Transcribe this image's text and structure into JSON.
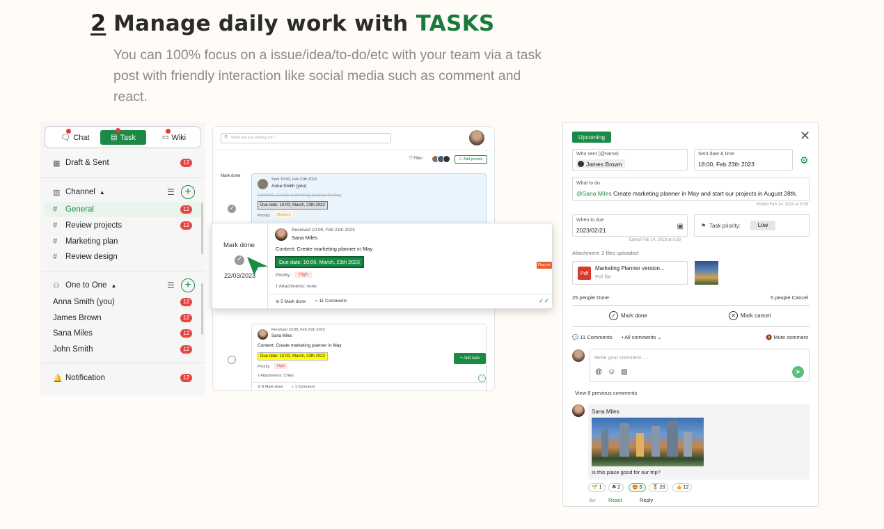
{
  "header": {
    "step_number": "2",
    "title_prefix": "Manage daily work with ",
    "title_accent": "TASKS",
    "description": "You can 100% focus on a issue/idea/to-do/etc with your team via a task post with friendly interaction like social media such as comment and react."
  },
  "sidebar": {
    "tabs": [
      {
        "label": "Chat",
        "icon": "chat-icon"
      },
      {
        "label": "Task",
        "icon": "task-icon"
      },
      {
        "label": "Wiki",
        "icon": "wiki-icon"
      }
    ],
    "draft": {
      "label": "Draft & Sent",
      "badge": "12"
    },
    "channel": {
      "label": "Channel",
      "items": [
        {
          "label": "General",
          "badge": "12"
        },
        {
          "label": "Review projects",
          "badge": "12"
        },
        {
          "label": "Marketing plan"
        },
        {
          "label": "Review design"
        }
      ]
    },
    "one_to_one": {
      "label": "One to One",
      "items": [
        {
          "label": "Anna Smith (you)",
          "badge": "12"
        },
        {
          "label": "James Brown",
          "badge": "12"
        },
        {
          "label": "Sana Miles",
          "badge": "12"
        },
        {
          "label": "John Smith",
          "badge": "12"
        }
      ]
    },
    "notification": {
      "label": "Notification",
      "badge": "12"
    }
  },
  "task_list": {
    "search_placeholder": "What are you looking for?",
    "filter_label": "Filter",
    "add_people_label": "Add people",
    "card1": {
      "side_label": "Mark done",
      "sent": "Sent 10:00, Feb 21th 2023",
      "author": "Anna Smith (you)",
      "content": "Content: Create marketing planner in May",
      "due": "Due date: 10:00, March, 23th 2023",
      "priority_label": "Priority:",
      "priority": "Medium"
    },
    "card2": {
      "side_label": "Mark done",
      "date": "22/03/2023",
      "received": "Received 10:00, Feb 21th 2023",
      "author": "Sana Miles",
      "content": "Content: Create marketing planner in May",
      "due": "Due date: 10:00, March, 23th 2023",
      "priority_label": "Priority:",
      "priority": "High",
      "attachments": "Attachments: none",
      "mark_done_count": "5 Mark done",
      "comments_count": "11 Comments",
      "flag": "Flag set"
    },
    "card3": {
      "received": "Received 10:00, Feb 21th 2023",
      "author": "Sana Miles",
      "content": "Content: Create marketing planner in May",
      "due": "Due date: 10:00, March, 23th 2023",
      "priority_label": "Priority:",
      "priority": "High",
      "attachments": "Attachments: 5 files",
      "mark_done_count": "8 Mark done",
      "comments_count": "1 Comment",
      "add_task": "Add task"
    }
  },
  "detail": {
    "status": "Upcoming",
    "who_sent_label": "Who sent (@name)",
    "who_sent": "James Brown",
    "sent_dt_label": "Sent date & time",
    "sent_dt": "18:00, Feb 23th 2023",
    "what_label": "What to do",
    "what_mention": "@Sana Miles",
    "what_text": " Create marketing planner in May and start our projects in August 28th,",
    "edited1": "Edited Feb 14, 2023 at 9:38",
    "when_label": "When to due",
    "when_value": "2023/02/21",
    "edited2": "Edited Feb 14, 2023 at 9:38",
    "priority_label": "Task priority:",
    "priority_value": "Low",
    "attachments_label": "Attachment: 2 files uploaded",
    "file_name": "Marketing Planner version...",
    "file_type": "Pdf file",
    "file_icon": "Pdf",
    "people_done": "25 people Done",
    "people_cancel": "5 people Cancel",
    "mark_done": "Mark done",
    "mark_cancel": "Mark cancel",
    "comments_count": "11 Comments",
    "all_comments": "All comments",
    "mute": "Mute comment",
    "comment_placeholder": "Write your comment.....",
    "view_previous": "View 6 previous comments",
    "comment_author": "Sana Miles",
    "comment_text": "Is this place good for our trip?",
    "reactions": [
      {
        "emoji": "🌱",
        "count": "1"
      },
      {
        "emoji": "☘",
        "count": "2"
      },
      {
        "emoji": "😍",
        "count": "5"
      },
      {
        "emoji": "🏅",
        "count": "20"
      },
      {
        "emoji": "👍",
        "count": "12"
      }
    ],
    "time_ago": "8w",
    "react_label": "React",
    "reply_label": "Reply"
  },
  "colors": {
    "brand_green": "#1a8a46",
    "badge_red": "#e64545",
    "title_accent": "#1a7a3c"
  }
}
